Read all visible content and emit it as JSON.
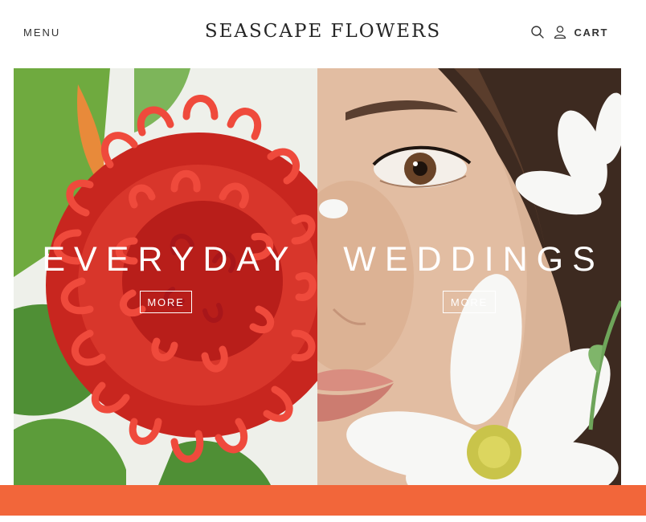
{
  "header": {
    "menu_label": "MENU",
    "brand": "SEASCAPE FLOWERS",
    "search_icon": "search-icon",
    "user_icon": "user-icon",
    "cart_label": "CART"
  },
  "hero": {
    "panels": [
      {
        "title": "EVERYDAY",
        "button_label": "MORE"
      },
      {
        "title": "WEDDINGS",
        "button_label": "MORE"
      }
    ]
  },
  "colors": {
    "accent_band": "#f2663a",
    "text_dark": "#2b2b2b",
    "overlay_text": "#ffffff"
  }
}
